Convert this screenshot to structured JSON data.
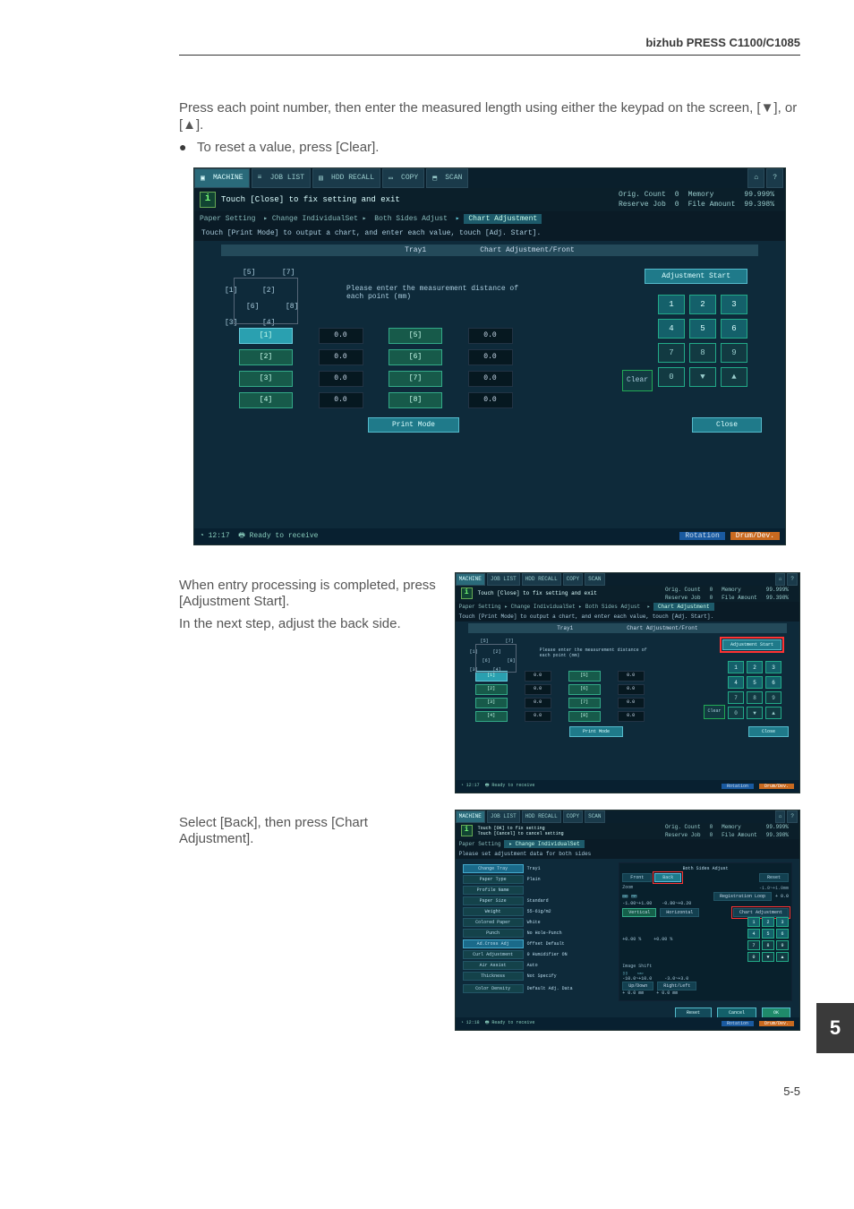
{
  "header": {
    "model": "bizhub PRESS C1100/C1085"
  },
  "intro": {
    "p1": "Press each point number, then enter the measured length using either the keypad on the screen, [▼], or [▲].",
    "bullet": "To reset a value, press [Clear]."
  },
  "shot": {
    "tabs": {
      "machine": "MACHINE",
      "joblist": "JOB LIST",
      "hdd": "HDD RECALL",
      "copy": "COPY",
      "scan": "SCAN"
    },
    "info_msg": "Touch [Close] to fix setting and exit",
    "status": {
      "orig_count_l": "Orig. Count",
      "orig_count_v": "0",
      "reserve_l": "Reserve Job",
      "reserve_v": "0",
      "memory_l": "Memory",
      "memory_v": "99.999%",
      "file_l": "File Amount",
      "file_v": "99.398%"
    },
    "crumb": {
      "c1": "Paper Setting",
      "c2": "▸ Change IndividualSet ▸",
      "c3": "Both Sides Adjust",
      "c4": "Chart Adjustment"
    },
    "instr": "Touch [Print Mode] to output a chart, and enter each value, touch [Adj. Start].",
    "sub_l": "Tray1",
    "sub_r": "Chart Adjustment/Front",
    "diagram": {
      "p1": "[1]",
      "p2": "[2]",
      "p3": "[3]",
      "p4": "[4]",
      "p5": "[5]",
      "p6": "[6]",
      "p7": "[7]",
      "p8": "[8]"
    },
    "meas_text": "Please enter the measurement distance of each point (mm)",
    "values": {
      "l1": "[1]",
      "v1": "0.0",
      "l5": "[5]",
      "v5": "0.0",
      "l2": "[2]",
      "v2": "0.0",
      "l6": "[6]",
      "v6": "0.0",
      "l3": "[3]",
      "v3": "0.0",
      "l7": "[7]",
      "v7": "0.0",
      "l4": "[4]",
      "v4": "0.0",
      "l8": "[8]",
      "v8": "0.0"
    },
    "adj_start": "Adjustment Start",
    "keypad": {
      "k1": "1",
      "k2": "2",
      "k3": "3",
      "k4": "4",
      "k5": "5",
      "k6": "6",
      "k7": "7",
      "k8": "8",
      "k9": "9",
      "k0": "0",
      "kd": "▼",
      "ku": "▲",
      "clear": "Clear"
    },
    "print_mode": "Print Mode",
    "close": "Close",
    "statusbar": {
      "time": "12:17",
      "ready": "Ready to receive",
      "rot": "Rotation",
      "drum": "Drum/Dev."
    }
  },
  "steps": {
    "s2a": "When entry processing is completed, press [Adjustment Start].",
    "s2b": "In the next step, adjust the back side.",
    "s3": "Select [Back], then press [Chart Adjustment]."
  },
  "thumb3": {
    "info_msg": "Touch [OK] to fix setting\nTouch [Cancel] to cancel setting",
    "crumb1": "Paper Setting",
    "crumb2": "▸ Change IndividualSet",
    "instr": "Please set adjustment data for both sides",
    "change_tray": "Change Tray",
    "tray": "Tray1",
    "title_r": "Both Sides Adjust",
    "front": "Front",
    "back": "Back",
    "reset": "Reset",
    "left_rows": {
      "paper_type_l": "Paper Type",
      "paper_type_v": "Plain",
      "profile_l": "Profile Name",
      "profile_v": "",
      "paper_size_l": "Paper Size",
      "paper_size_v": "Standard",
      "weight_l": "Weight",
      "weight_v": "55-61g/m2",
      "colored_l": "Colored Paper",
      "colored_v": "White",
      "punch_l": "Punch",
      "punch_v": "No Hole-Punch",
      "adjcross_l": "Ad.Cross Adj",
      "adjcross_v": "Offset Default",
      "curl_l": "Curl Adjustment",
      "curl_v": "0  Humidifier ON",
      "air_l": "Air Assist",
      "air_v": "Auto",
      "thickness_l": "Thickness",
      "thickness_v": "Not Specify",
      "color_density_l": "Color Density",
      "color_density_v": "Default Adj. Data"
    },
    "right": {
      "zoom_t": "Zoom",
      "zoom_rng": "-1.0~+1.0mm",
      "zoom_l": "-1.00~+1.00",
      "zoom_r": "-0.80~+0.20",
      "reg_t": "Registration Loop",
      "reg_v": "+ 0.0",
      "chart_adj": "Chart Adjustment",
      "vert": "Vertical",
      "horiz": "Horizontal",
      "vert_v": "+0.00 %",
      "horiz_v": "+0.00 %",
      "image_t": "Image Shift",
      "image_rng": "-10.0~+10.0",
      "ud_l": "-10.0~+10.0",
      "ud_r": "-3.0~+3.0",
      "upd": "Up/Down",
      "lr": "Right/Left",
      "upd_v": "+ 0.0 mm",
      "lr_v": "+ 0.0 mm"
    },
    "foot": {
      "reset": "Reset",
      "cancel": "Cancel",
      "ok": "OK"
    },
    "statusbar": {
      "time": "12:18"
    }
  },
  "side_tab": "5",
  "page_num": "5-5"
}
